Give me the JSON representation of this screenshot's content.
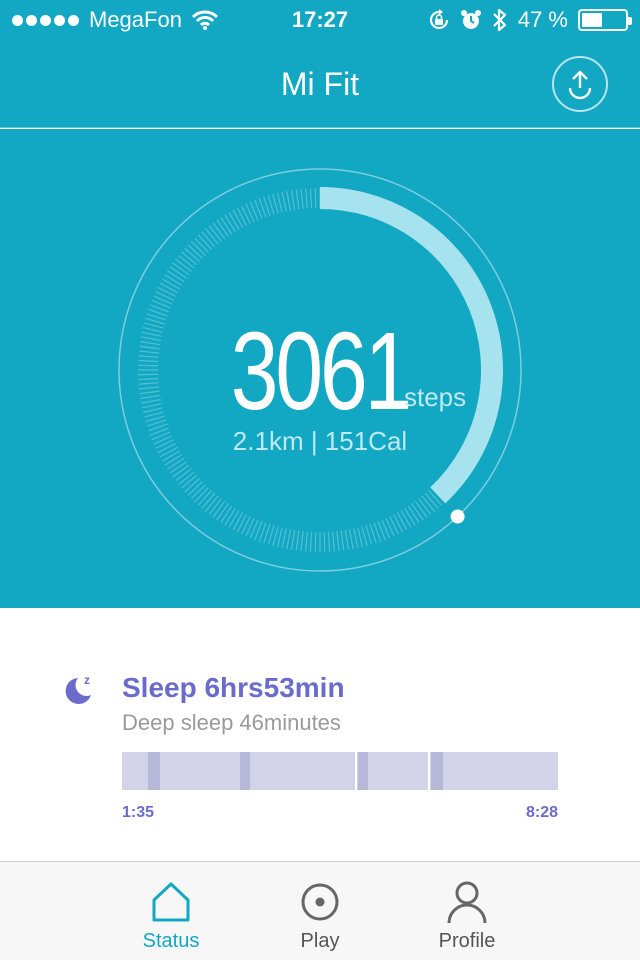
{
  "status_bar": {
    "carrier": "MegaFon",
    "time": "17:27",
    "battery_percent_text": "47 %",
    "battery_level": 0.47,
    "icons": [
      "signal-dots-icon",
      "wifi-icon",
      "rotation-lock-icon",
      "alarm-icon",
      "bluetooth-icon",
      "battery-icon"
    ]
  },
  "nav": {
    "title": "Mi Fit",
    "upload_icon": "upload-icon"
  },
  "steps": {
    "count": "3061",
    "unit": "steps",
    "summary": "2.1km | 151Cal",
    "progress_fraction": 0.38
  },
  "sleep": {
    "icon": "moon-icon",
    "title": "Sleep 6hrs53min",
    "subtitle": "Deep sleep 46minutes",
    "start_time": "1:35",
    "end_time": "8:28"
  },
  "tabs": [
    {
      "label": "Status",
      "icon": "home-icon",
      "active": true
    },
    {
      "label": "Play",
      "icon": "play-icon",
      "active": false
    },
    {
      "label": "Profile",
      "icon": "profile-icon",
      "active": false
    }
  ],
  "colors": {
    "primary": "#12a7c3",
    "sleep_accent": "#6b6bcc",
    "sleep_bar": "#d2d2e8"
  }
}
